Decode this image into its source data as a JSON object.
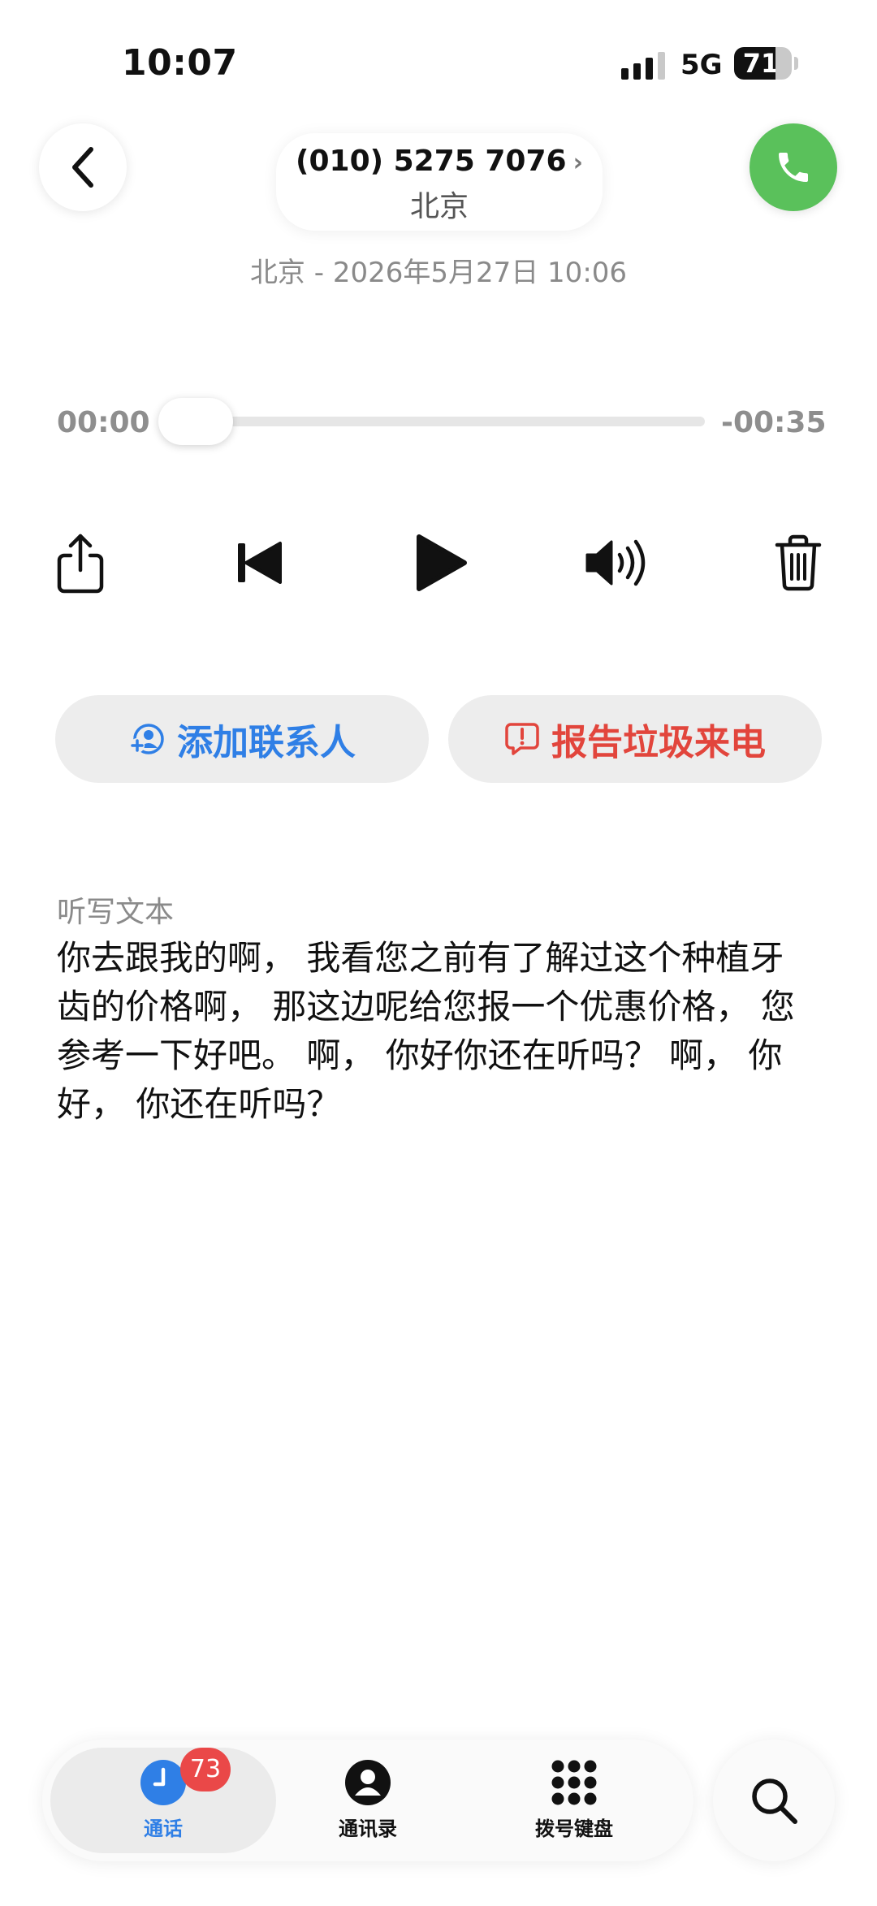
{
  "status_bar": {
    "time": "10:07",
    "network": "5G",
    "battery": "71"
  },
  "header": {
    "phone_number": "(010) 5275 7076",
    "chevron": "›",
    "location": "北京",
    "subtitle": "北京 - 2026年5月27日 10:06"
  },
  "player": {
    "current_time": "00:00",
    "remaining_time": "-00:35",
    "progress": 0
  },
  "actions": {
    "add_contact": "添加联系人",
    "report_spam": "报告垃圾来电"
  },
  "transcript": {
    "label": "听写文本",
    "text": "你去跟我的啊， 我看您之前有了解过这个种植牙齿的价格啊， 那这边呢给您报一个优惠价格， 您参考一下好吧。 啊， 你好你还在听吗？ 啊， 你好， 你还在听吗？"
  },
  "tabbar": {
    "tabs": [
      {
        "label": "通话",
        "icon": "clock-icon",
        "active": true
      },
      {
        "label": "通讯录",
        "icon": "person-icon",
        "active": false
      },
      {
        "label": "拨号键盘",
        "icon": "keypad-icon",
        "active": false
      }
    ],
    "badge": "73"
  },
  "colors": {
    "accent_blue": "#2f7fe6",
    "danger_red": "#e2453c",
    "call_green": "#5ac15b",
    "badge_red": "#ea4848"
  }
}
